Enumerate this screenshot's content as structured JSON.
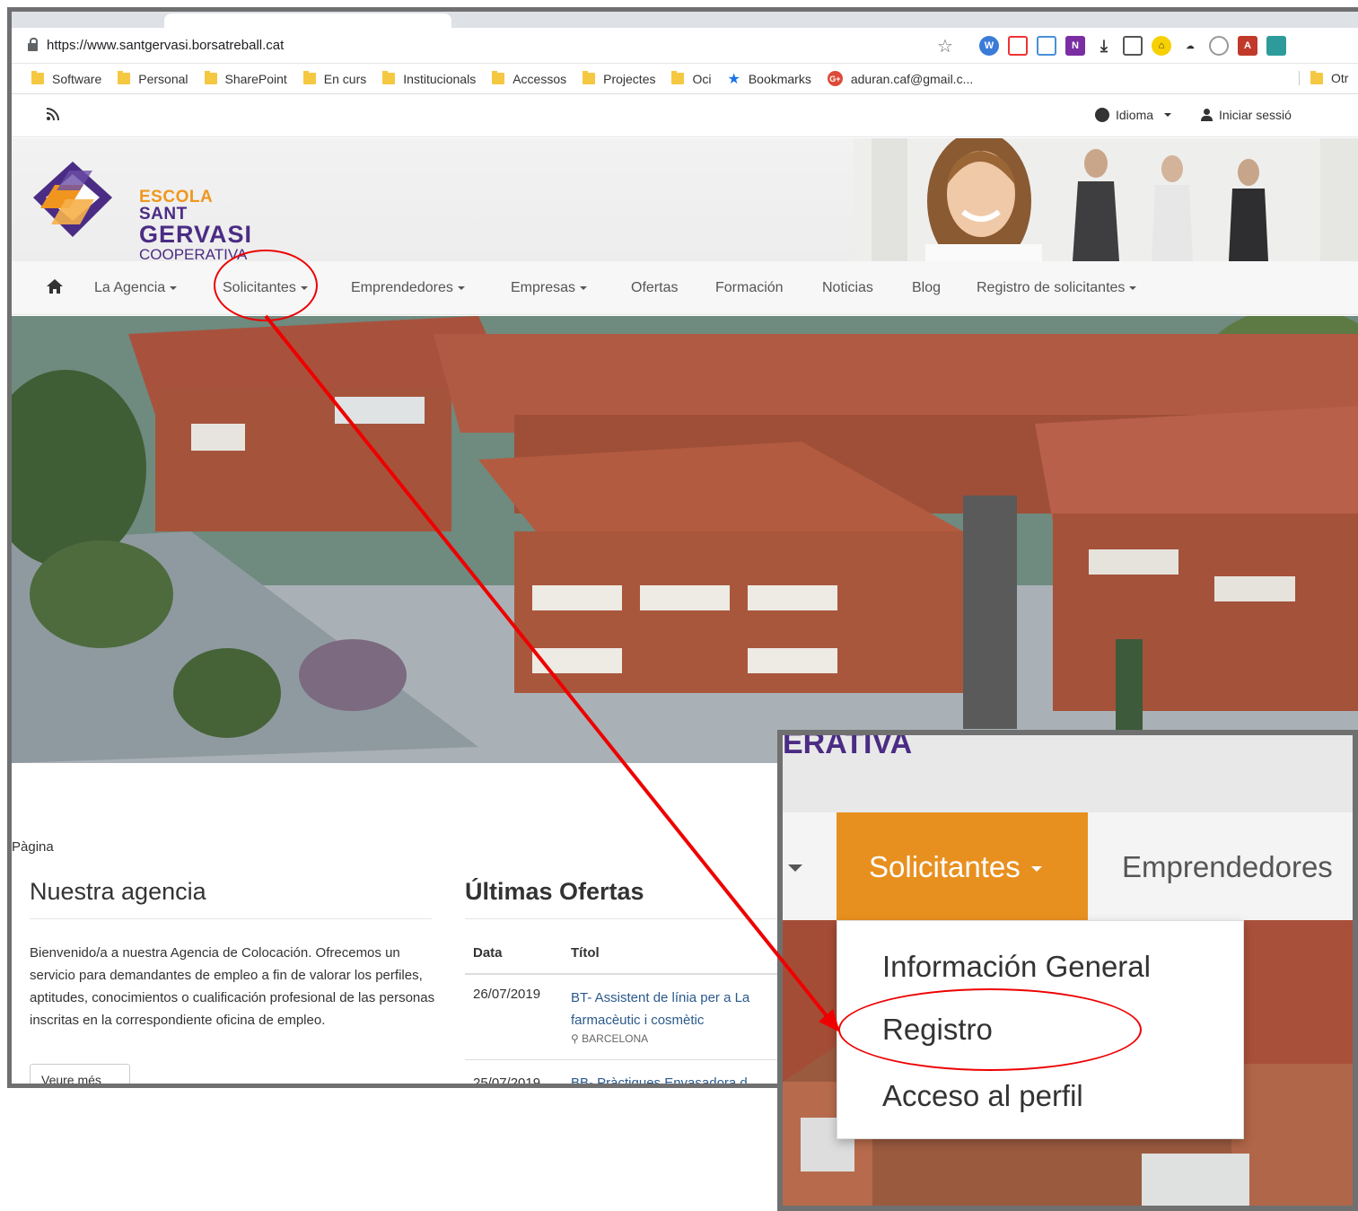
{
  "browser": {
    "url": "https://www.santgervasi.borsatreball.cat",
    "bookmarks": [
      {
        "label": "Software"
      },
      {
        "label": "Personal"
      },
      {
        "label": "SharePoint"
      },
      {
        "label": "En curs"
      },
      {
        "label": "Institucionals"
      },
      {
        "label": "Accessos"
      },
      {
        "label": "Projectes"
      },
      {
        "label": "Oci"
      },
      {
        "label": "Bookmarks"
      },
      {
        "label": "aduran.caf@gmail.c..."
      }
    ],
    "other_bookmarks": "Otr",
    "extension_icons": [
      "w-icon",
      "pocket-icon",
      "screenshot-icon",
      "onenote-icon",
      "download-icon",
      "layout-icon",
      "extension-icon",
      "cloud-icon",
      "github-icon",
      "pdf-icon",
      "window-icon"
    ]
  },
  "topbar": {
    "idioma": "Idioma",
    "login": "Iniciar sessió"
  },
  "logo": {
    "line1a": "ESCOLA",
    "line1b": " SANT",
    "line2": "GERVASI",
    "line3": "COOPERATIVA"
  },
  "nav": {
    "items": [
      "La Agencia",
      "Solicitantes",
      "Emprendedores",
      "Empresas",
      "Ofertas",
      "Formación",
      "Noticias",
      "Blog",
      "Registro de solicitantes"
    ]
  },
  "page": {
    "pagina": "Pàgina",
    "agency_title": "Nuestra agencia",
    "agency_text": "Bienvenido/a a nuestra Agencia de Colocación. Ofrecemos un servicio para demandantes de empleo a fin de valorar los perfiles, aptitudes, conocimientos o cualificación profesional de las personas inscritas en la correspondiente oficina de empleo.",
    "more_button": "Veure més",
    "offers_title": "Últimas Ofertas",
    "table_headers": [
      "Data",
      "Títol"
    ],
    "offers": [
      {
        "date": "26/07/2019",
        "title": "BT- Assistent de línia per a La farmacèutic i cosmètic",
        "location": "BARCELONA"
      },
      {
        "date": "25/07/2019",
        "title": "BB- Pràctiques Envasadora d"
      }
    ]
  },
  "zoom": {
    "header_fragment": "ERATIVA",
    "solicitantes": "Solicitantes",
    "emprendedores": "Emprendedores",
    "menu": [
      "Información General",
      "Registro",
      "Acceso al perfil"
    ]
  },
  "colors": {
    "accent_orange": "#e8901f",
    "brand_purple": "#4b2c84",
    "annotation_red": "#e00000"
  }
}
